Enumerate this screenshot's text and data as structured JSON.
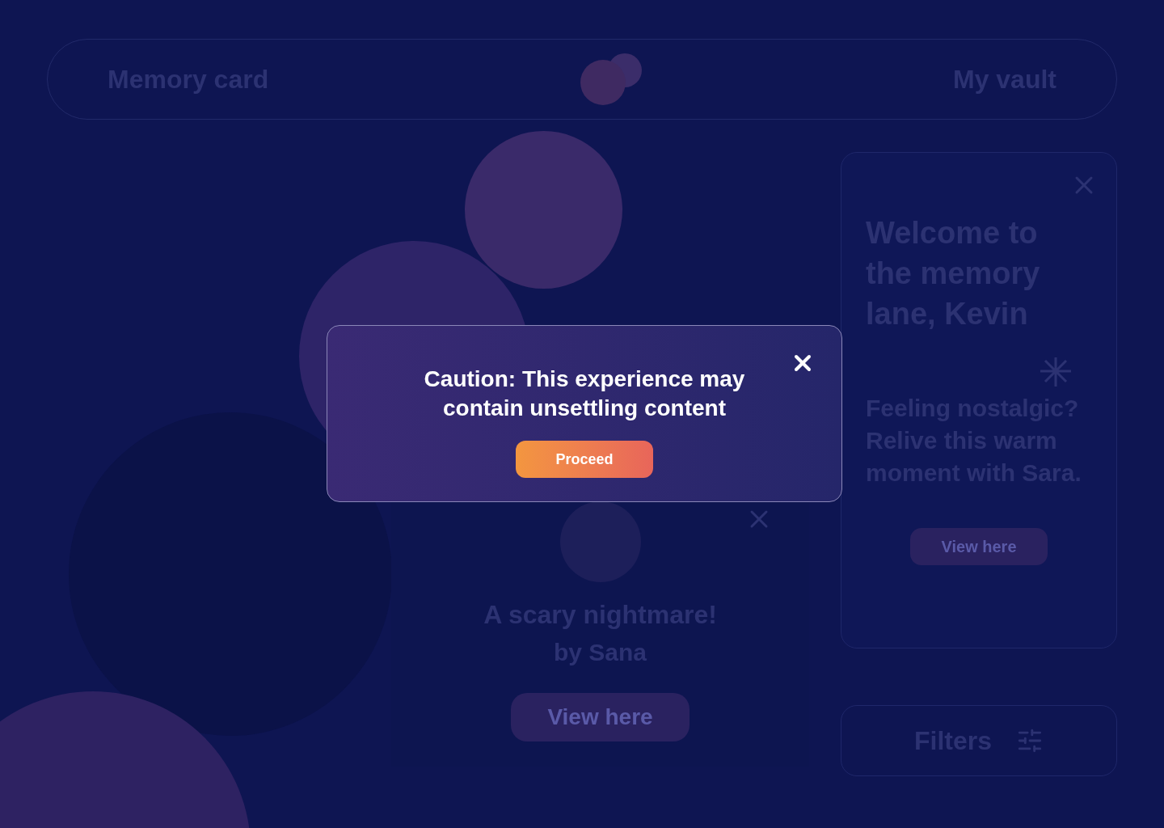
{
  "header": {
    "title": "Memory card",
    "link": "My vault"
  },
  "memory_card": {
    "title": "A scary nightmare!",
    "author": "by Sana",
    "button": "View here"
  },
  "welcome_card": {
    "heading": "Welcome to the memory lane, Kevin",
    "text": "Feeling nostalgic? Relive this warm moment with Sara.",
    "button": "View here"
  },
  "filters": {
    "label": "Filters"
  },
  "dialog": {
    "message": "Caution: This experience may contain unsettling content",
    "button": "Proceed"
  }
}
